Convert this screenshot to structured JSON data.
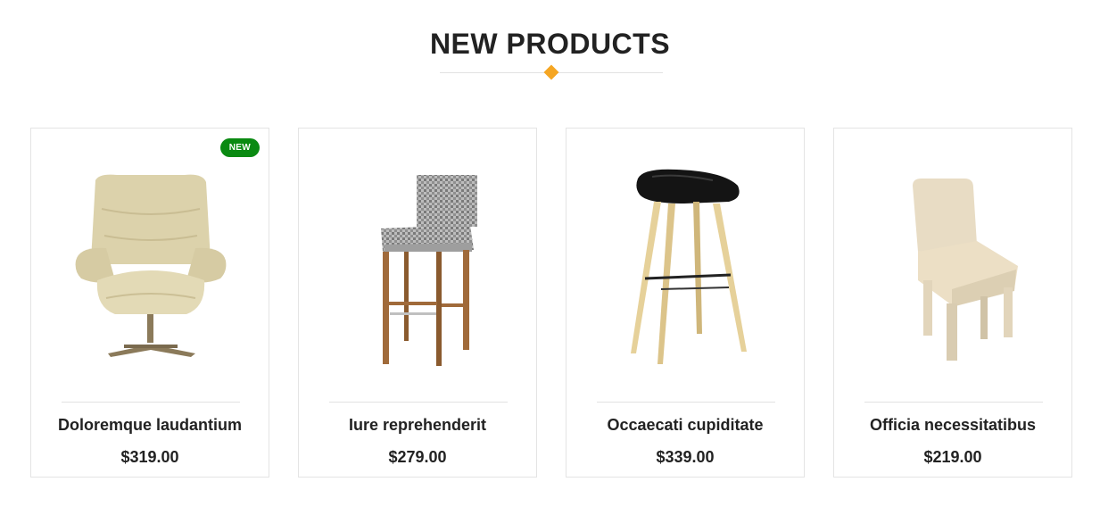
{
  "section": {
    "title": "NEW PRODUCTS",
    "accent_color": "#f5a623"
  },
  "products": [
    {
      "name": "Doloremque laudantium",
      "price": "$319.00",
      "badge": "NEW",
      "image_icon": "lounge-chair-image"
    },
    {
      "name": "Iure reprehenderit",
      "price": "$279.00",
      "image_icon": "bar-stool-image"
    },
    {
      "name": "Occaecati cupiditate",
      "price": "$339.00",
      "image_icon": "black-stool-image"
    },
    {
      "name": "Officia necessitatibus",
      "price": "$219.00",
      "image_icon": "dining-chair-image"
    }
  ],
  "colors": {
    "badge": "#0a8a12",
    "text": "#222222",
    "border": "#e4e4e4"
  }
}
